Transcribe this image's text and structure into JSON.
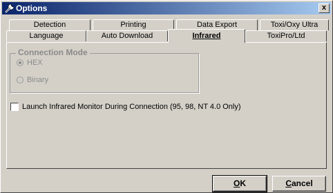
{
  "window": {
    "title": "Options",
    "close_label": "x"
  },
  "tabs_row1": [
    "Detection",
    "Printing",
    "Data Export",
    "Toxi/Oxy Ultra"
  ],
  "tabs_row2": [
    "Language",
    "Auto Download",
    "Infrared",
    "ToxiPro/Ltd"
  ],
  "active_tab": "Infrared",
  "connection_mode": {
    "label": "Connection Mode",
    "options": [
      "HEX",
      "Binary"
    ],
    "selected": "HEX",
    "enabled": false
  },
  "launch_monitor": {
    "label": "Launch Infrared Monitor During Connection  (95, 98, NT 4.0 Only)",
    "checked": false
  },
  "buttons": {
    "ok_rest": "K",
    "ok_mnemonic": "O",
    "cancel_rest": "ancel",
    "cancel_mnemonic": "C"
  },
  "colors": {
    "title_gradient_start": "#0a246a",
    "title_gradient_end": "#a6caf0",
    "face": "#d4d0c8"
  },
  "icons": {
    "title_icon": "wrench-icon",
    "close": "close-icon"
  }
}
